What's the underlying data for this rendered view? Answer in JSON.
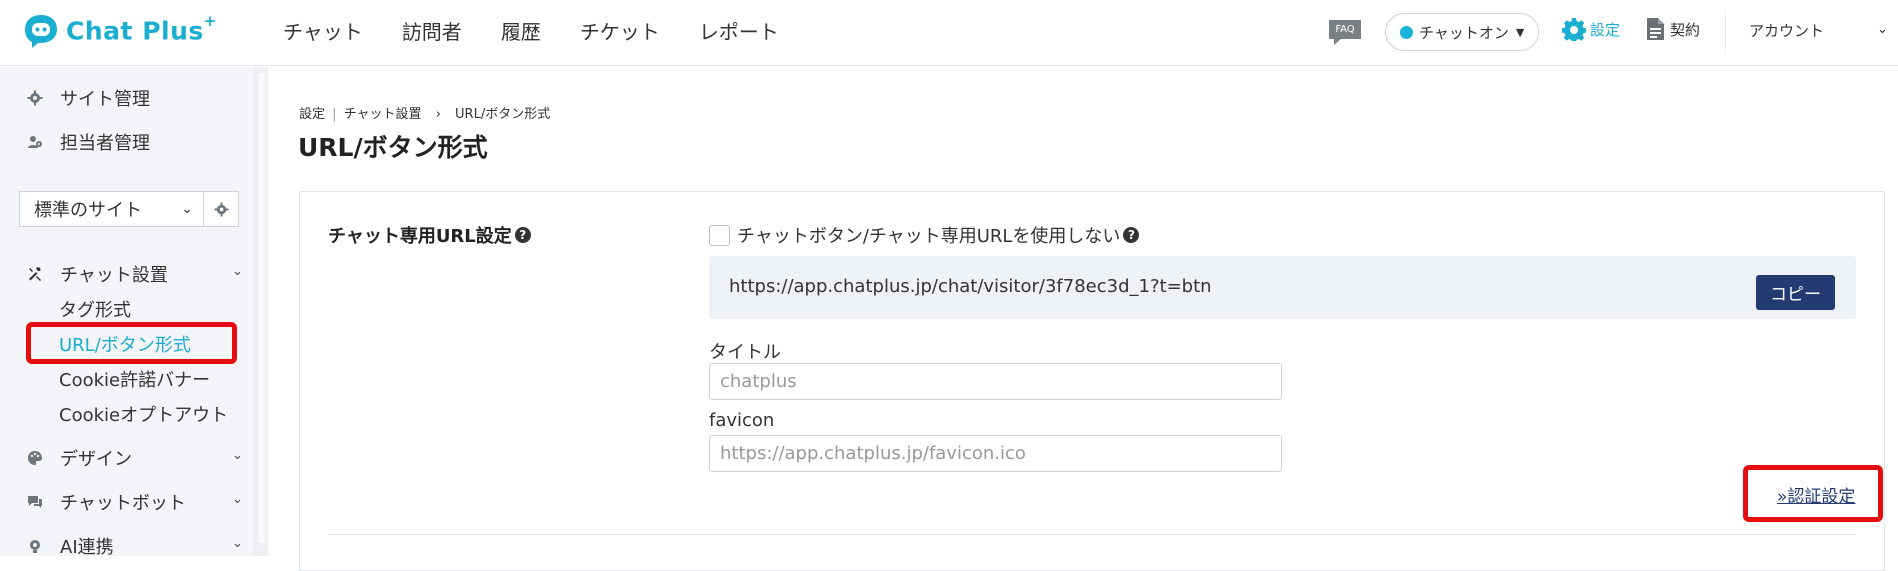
{
  "brand": {
    "name_part1": "Chat",
    "name_part2": "Plus",
    "superscript": "+"
  },
  "nav": [
    {
      "label": "チャット"
    },
    {
      "label": "訪問者"
    },
    {
      "label": "履歴"
    },
    {
      "label": "チケット"
    },
    {
      "label": "レポート"
    }
  ],
  "header": {
    "faq_label": "FAQ",
    "status_label": "チャットオン",
    "settings_label": "設定",
    "contract_label": "契約",
    "account_label": "アカウント"
  },
  "sidebar": {
    "top_items": [
      {
        "label": "サイト管理",
        "icon": "gear-icon"
      },
      {
        "label": "担当者管理",
        "icon": "user-icon"
      }
    ],
    "site_select": {
      "value": "標準のサイト"
    },
    "chat_setup": {
      "label": "チャット設置",
      "sub_items": [
        {
          "label": "タグ形式"
        },
        {
          "label": "URL/ボタン形式"
        },
        {
          "label": "Cookie許諾バナー"
        },
        {
          "label": "Cookieオプトアウト"
        }
      ]
    },
    "groups": [
      {
        "label": "デザイン",
        "icon": "palette-icon"
      },
      {
        "label": "チャットボット",
        "icon": "chat-bubble-icon"
      },
      {
        "label": "AI連携",
        "icon": "ai-icon"
      }
    ]
  },
  "breadcrumb": {
    "part1": "設定",
    "sep": "|",
    "part2": "チャット設置",
    "arrow": "›",
    "part3": "URL/ボタン形式"
  },
  "page_title": "URL/ボタン形式",
  "section": {
    "label": "チャット専用URL設定",
    "help": "?",
    "checkbox_label": "チャットボタン/チャット専用URLを使用しない",
    "url": "https://app.chatplus.jp/chat/visitor/3f78ec3d_1?t=btn",
    "copy_label": "コピー",
    "title_label": "タイトル",
    "title_placeholder": "chatplus",
    "favicon_label": "favicon",
    "favicon_placeholder": "https://app.chatplus.jp/favicon.ico",
    "auth_link": "»認証設定"
  },
  "colors": {
    "accent": "#1aaed0",
    "navy": "#233a72",
    "highlight": "#e50d0d"
  }
}
